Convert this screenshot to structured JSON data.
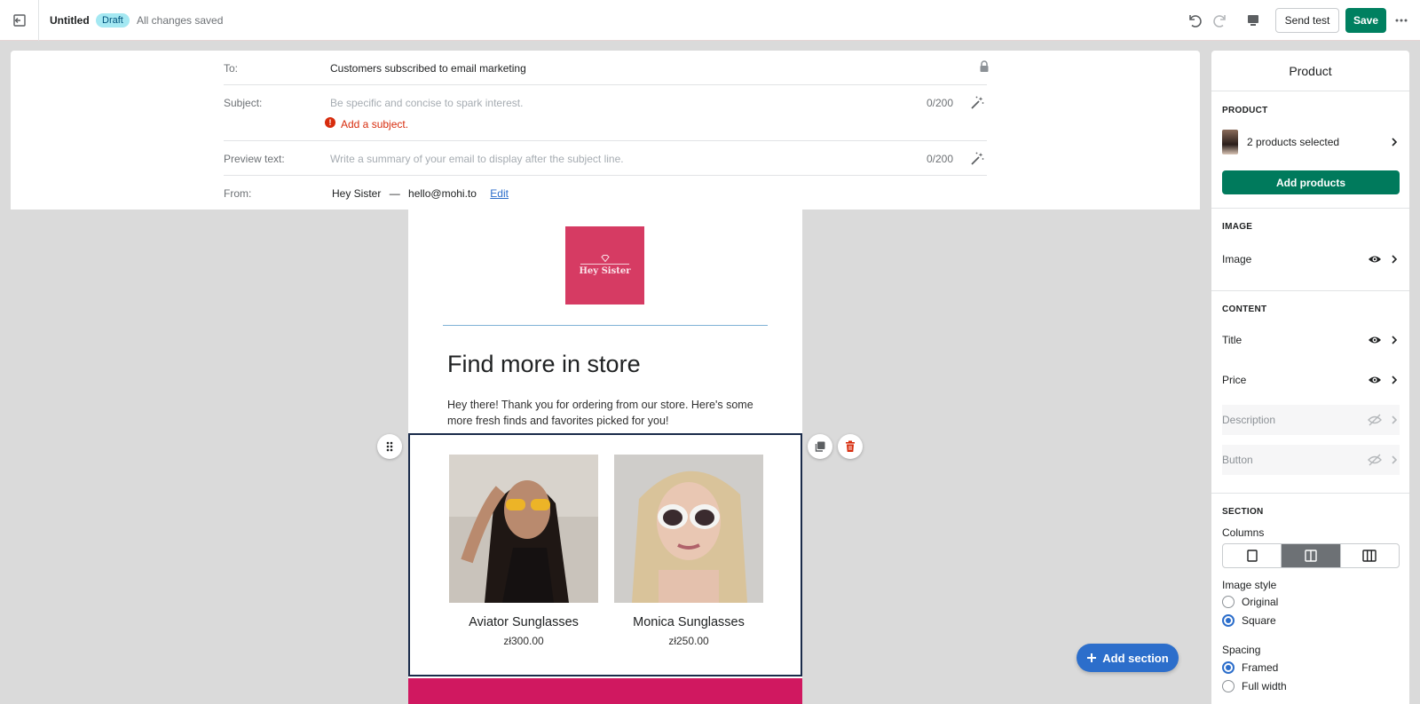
{
  "topbar": {
    "title": "Untitled",
    "status_badge": "Draft",
    "save_status": "All changes saved",
    "send_test_label": "Send test",
    "save_label": "Save"
  },
  "header": {
    "to_label": "To:",
    "to_value": "Customers subscribed to email marketing",
    "subject_label": "Subject:",
    "subject_placeholder": "Be specific and concise to spark interest.",
    "subject_counter": "0/200",
    "subject_error": "Add a subject.",
    "preview_label": "Preview text:",
    "preview_placeholder": "Write a summary of your email to display after the subject line.",
    "preview_counter": "0/200",
    "from_label": "From:",
    "from_name": "Hey Sister",
    "from_separator": "—",
    "from_email": "hello@mohi.to",
    "from_edit": "Edit"
  },
  "email": {
    "logo_text": "Hey Sister",
    "headline": "Find more in store",
    "body": "Hey there! Thank you for ordering from our store. Here's some more fresh finds and favorites picked for you!",
    "products": [
      {
        "title": "Aviator Sunglasses",
        "price": "zł300.00"
      },
      {
        "title": "Monica Sunglasses",
        "price": "zł250.00"
      }
    ]
  },
  "add_section_label": "Add section",
  "panel": {
    "title": "Product",
    "product_heading": "PRODUCT",
    "products_selected": "2 products selected",
    "add_products_label": "Add products",
    "image_heading": "IMAGE",
    "image_row": "Image",
    "content_heading": "CONTENT",
    "content_rows": [
      "Title",
      "Price",
      "Description",
      "Button"
    ],
    "section_heading": "SECTION",
    "columns_label": "Columns",
    "columns_selected": 2,
    "image_style_label": "Image style",
    "image_style_options": [
      "Original",
      "Square"
    ],
    "image_style_selected": "Square",
    "spacing_label": "Spacing",
    "spacing_options": [
      "Framed",
      "Full width"
    ],
    "spacing_selected": "Framed"
  },
  "colors": {
    "primary_green": "#008060",
    "accent_blue": "#2c6ecb",
    "logo_pink": "#d63b63",
    "footer_pink": "#d01860",
    "error_red": "#d72c0d"
  }
}
